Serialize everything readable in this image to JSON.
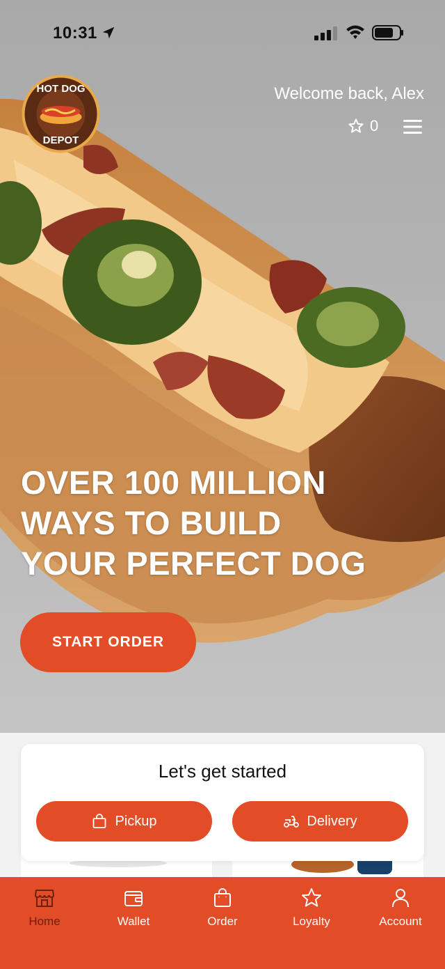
{
  "status_bar": {
    "time": "10:31"
  },
  "header": {
    "logo_text": "HOT DOG DEPOT",
    "welcome": "Welcome back, Alex",
    "points": "0"
  },
  "hero": {
    "headline_lines": [
      "OVER 100 MILLION",
      "WAYS TO BUILD",
      "YOUR PERFECT DOG"
    ],
    "cta_label": "START ORDER"
  },
  "get_started": {
    "title": "Let's get started",
    "pickup_label": "Pickup",
    "delivery_label": "Delivery"
  },
  "nav": {
    "items": [
      {
        "label": "Home",
        "icon": "store-icon",
        "active": true
      },
      {
        "label": "Wallet",
        "icon": "wallet-icon",
        "active": false
      },
      {
        "label": "Order",
        "icon": "bag-icon",
        "active": false
      },
      {
        "label": "Loyalty",
        "icon": "star-icon",
        "active": false
      },
      {
        "label": "Account",
        "icon": "person-icon",
        "active": false
      }
    ]
  },
  "colors": {
    "accent": "#e24c27",
    "nav_active": "#6b1f0d"
  }
}
